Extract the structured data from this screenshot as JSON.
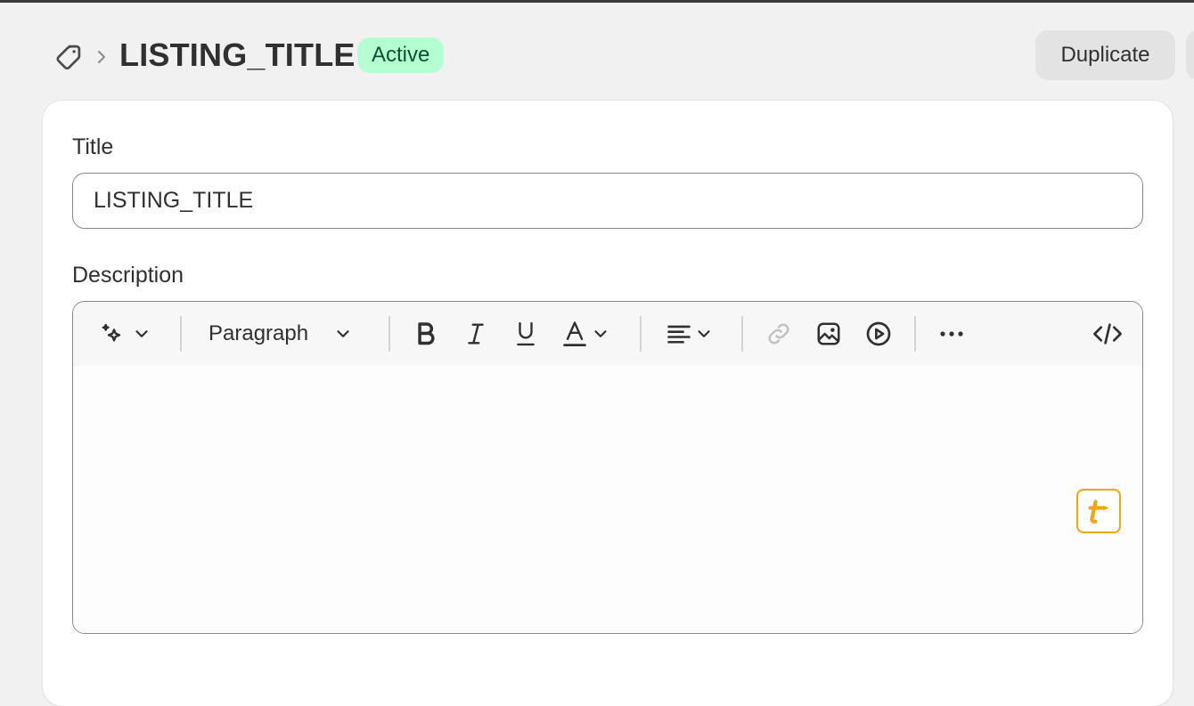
{
  "header": {
    "title": "LISTING_TITLE",
    "status": "Active",
    "duplicate_label": "Duplicate",
    "icons": {
      "breadcrumb": "tag-icon",
      "separator": "chevron-right-icon"
    }
  },
  "form": {
    "title_label": "Title",
    "title_value": "LISTING_TITLE",
    "description_label": "Description"
  },
  "toolbar": {
    "paragraph_label": "Paragraph",
    "icons": [
      "magic-sparkle-icon",
      "bold-icon",
      "italic-icon",
      "underline-icon",
      "text-color-icon",
      "align-left-icon",
      "link-icon",
      "image-icon",
      "video-icon",
      "more-icon",
      "code-icon"
    ]
  },
  "colors": {
    "badge_bg": "#b4fed2",
    "badge_text": "#0c5132",
    "extension_accent": "#f4a50c",
    "page_bg": "#f1f1f1"
  }
}
